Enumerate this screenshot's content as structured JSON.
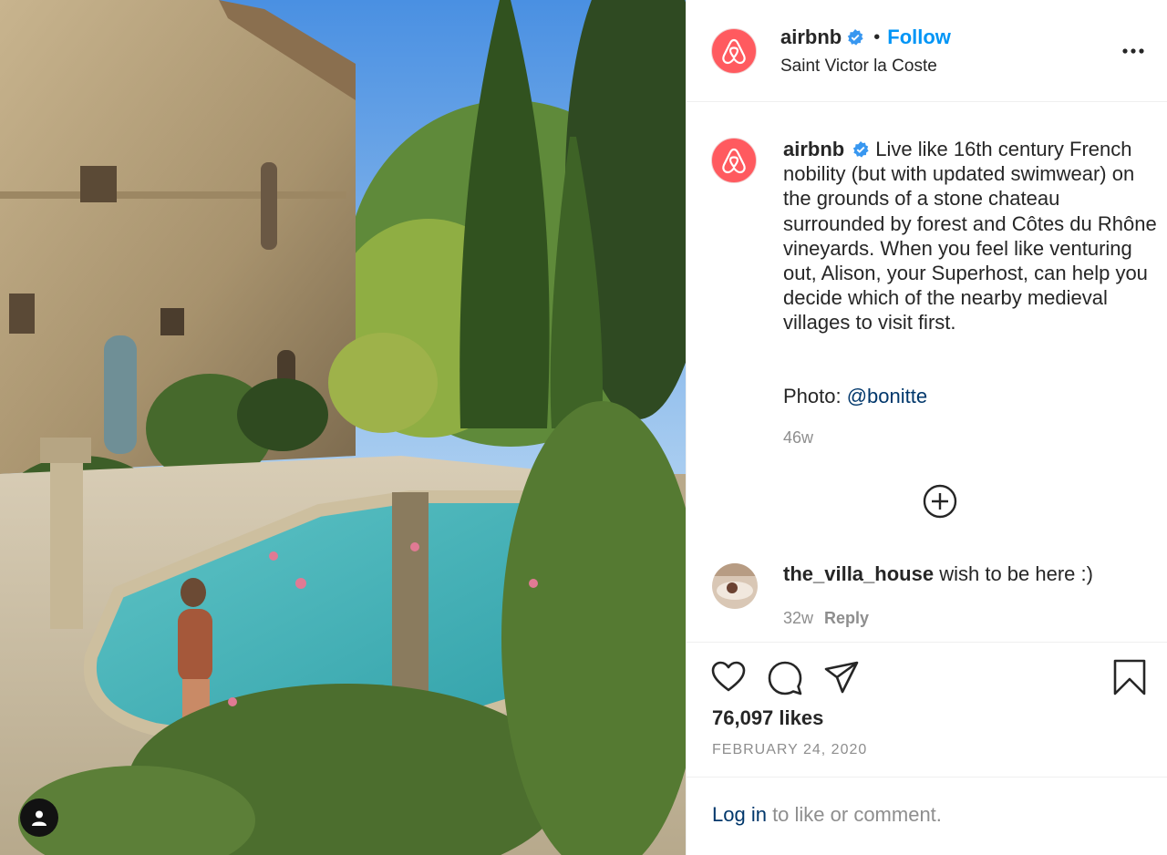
{
  "post": {
    "account": "airbnb",
    "follow_label": "Follow",
    "location": "Saint Victor la Coste",
    "caption": "Live like 16th century French nobility (but with updated swimwear) on the grounds of a stone chateau surrounded by forest and Côtes du Rhône vineyards. When you feel like venturing out, Alison, your Superhost, can help you decide which of the nearby medieval villages to visit first.",
    "photo_credit_prefix": "Photo: ",
    "photo_credit_handle": "@bonitte",
    "caption_age": "46w",
    "likes": "76,097 likes",
    "date": "FEBRUARY 24, 2020"
  },
  "comment": {
    "username": "the_villa_house",
    "text": "wish to be here :)",
    "age": "32w",
    "reply_label": "Reply"
  },
  "footer": {
    "login_link": "Log in",
    "login_rest": " to like or comment."
  },
  "icons": {
    "avatar": "airbnb-logo-icon",
    "verified": "verified-badge-icon",
    "more": "more-options-icon",
    "load_more": "plus-circle-icon",
    "like": "heart-icon",
    "comment": "comment-bubble-icon",
    "share": "paper-plane-icon",
    "save": "bookmark-icon",
    "tags": "user-tag-icon"
  },
  "colors": {
    "brand": "#ff5a5f",
    "link": "#0095f6",
    "mention": "#00376b",
    "muted": "#8e8e8e"
  }
}
